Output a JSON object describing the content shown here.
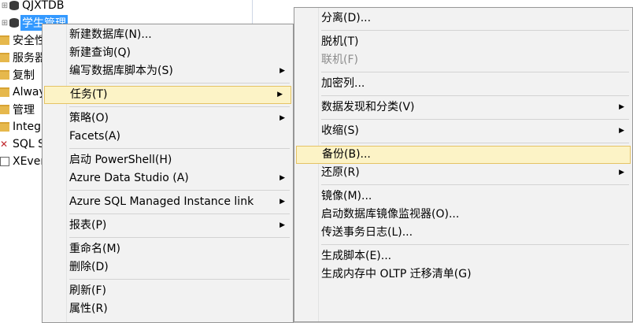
{
  "tree": {
    "nodes": [
      {
        "label": "QJXTDB",
        "icon": "database-icon"
      },
      {
        "label": "学生管理",
        "icon": "database-icon",
        "selected": true
      },
      {
        "label": "安全性",
        "icon": "folder-icon"
      },
      {
        "label": "服务器",
        "icon": "folder-icon"
      },
      {
        "label": "复制",
        "icon": "folder-icon"
      },
      {
        "label": "Alway",
        "icon": "folder-icon"
      },
      {
        "label": "管理",
        "icon": "folder-icon"
      },
      {
        "label": "Integr",
        "icon": "folder-icon"
      },
      {
        "label": "SQL S",
        "icon": "sql-agent-error-icon"
      },
      {
        "label": "XEven",
        "icon": "xevent-icon"
      }
    ]
  },
  "context_menu": {
    "items": [
      {
        "label": "新建数据库(N)...",
        "submenu": false
      },
      {
        "label": "新建查询(Q)",
        "submenu": false
      },
      {
        "label": "编写数据库脚本为(S)",
        "submenu": true
      },
      {
        "label": "任务(T)",
        "submenu": true,
        "highlighted": true
      },
      {
        "label": "策略(O)",
        "submenu": true
      },
      {
        "label": "Facets(A)",
        "submenu": false
      },
      {
        "label": "启动 PowerShell(H)",
        "submenu": false
      },
      {
        "label": "Azure Data Studio (A)",
        "submenu": true
      },
      {
        "label": "Azure SQL Managed Instance link",
        "submenu": true
      },
      {
        "label": "报表(P)",
        "submenu": true
      },
      {
        "label": "重命名(M)",
        "submenu": false
      },
      {
        "label": "删除(D)",
        "submenu": false
      },
      {
        "label": "刷新(F)",
        "submenu": false
      },
      {
        "label": "属性(R)",
        "submenu": false
      }
    ]
  },
  "tasks_menu": {
    "items": [
      {
        "label": "分离(D)...",
        "submenu": false
      },
      {
        "label": "脱机(T)",
        "submenu": false
      },
      {
        "label": "联机(F)",
        "submenu": false,
        "disabled": true
      },
      {
        "label": "加密列...",
        "submenu": false
      },
      {
        "label": "数据发现和分类(V)",
        "submenu": true
      },
      {
        "label": "收缩(S)",
        "submenu": true
      },
      {
        "label": "备份(B)...",
        "submenu": false,
        "highlighted": true
      },
      {
        "label": "还原(R)",
        "submenu": true
      },
      {
        "label": "镜像(M)...",
        "submenu": false
      },
      {
        "label": "启动数据库镜像监视器(O)...",
        "submenu": false
      },
      {
        "label": "传送事务日志(L)...",
        "submenu": false
      },
      {
        "label": "生成脚本(E)...",
        "submenu": false
      },
      {
        "label": "生成内存中 OLTP 迁移清单(G)",
        "submenu": false
      }
    ]
  },
  "colors": {
    "selection": "#3399ff",
    "menu_highlight_bg": "#fcf3c6",
    "menu_highlight_border": "#e5c365",
    "menu_bg": "#f2f2f2"
  }
}
